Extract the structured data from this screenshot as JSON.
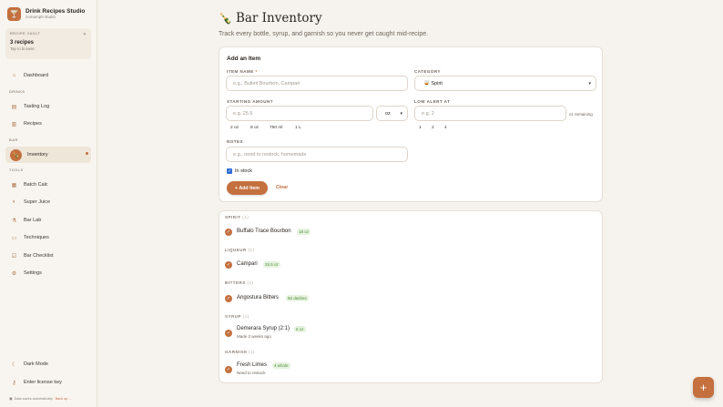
{
  "brand": {
    "name": "Drink Recipes Studio",
    "subtitle": "zomamp8 studio",
    "logo_icon": "glass-icon"
  },
  "vault": {
    "label": "RECIPE VAULT",
    "count": "3 recipes",
    "hint": "Tap to browse"
  },
  "nav": {
    "dashboard": "Dashboard",
    "drinks_label": "DRINKS",
    "tasting_log": "Tasting Log",
    "recipes": "Recipes",
    "bar_label": "BAR",
    "inventory": "Inventory",
    "tools_label": "TOOLS",
    "batch_calc": "Batch Calc",
    "super_juice": "Super Juice",
    "bar_lab": "Bar Lab",
    "techniques": "Techniques",
    "bar_checklist": "Bar Checklist",
    "settings": "Settings",
    "dark_mode": "Dark Mode",
    "license": "Enter license key"
  },
  "footer": {
    "text": "Data saves automatically.",
    "link": "Back up ..."
  },
  "page": {
    "title": "Bar Inventory",
    "subtitle": "Track every bottle, syrup, and garnish so you never get caught mid-recipe."
  },
  "form": {
    "title": "Add an Item",
    "item_name_label": "ITEM NAME",
    "required_mark": "*",
    "item_name_placeholder": "e.g., Bulleit Bourbon, Campari",
    "category_label": "CATEGORY",
    "category_value": "🥃 Spirit",
    "starting_amount_label": "STARTING AMOUNT",
    "starting_amount_placeholder": "e.g. 25.5",
    "unit_value": "oz",
    "low_alert_label": "LOW ALERT AT",
    "low_alert_placeholder": "e.g. 2",
    "or_remaining": "oz remaining",
    "amount_presets": [
      "2 oz",
      "8 oz",
      "750 ml",
      "1 L"
    ],
    "alert_presets": [
      "1",
      "2",
      "4"
    ],
    "notes_label": "NOTES",
    "notes_placeholder": "e.g., need to restock, homemade",
    "in_stock_label": "In stock",
    "in_stock": true,
    "add_button": "+ Add Item",
    "clear_button": "Clear"
  },
  "inventory": [
    {
      "category": "SPIRIT",
      "count": "(1)",
      "name": "Buffalo Trace Bourbon",
      "amount": "18 oz",
      "note": ""
    },
    {
      "category": "LIQUEUR",
      "count": "(1)",
      "name": "Campari",
      "amount": "25.5 oz",
      "note": ""
    },
    {
      "category": "BITTERS",
      "count": "(1)",
      "name": "Angostura Bitters",
      "amount": "50 dashes",
      "note": ""
    },
    {
      "category": "SYRUP",
      "count": "(1)",
      "name": "Demerara Syrup (2:1)",
      "amount": "6 oz",
      "note": "Made 2 weeks ago"
    },
    {
      "category": "GARNISH",
      "count": "(1)",
      "name": "Fresh Limes",
      "amount": "4 whole",
      "note": "Need to restock"
    }
  ],
  "fab": {
    "label": "+"
  },
  "colors": {
    "accent": "#c4703f",
    "badge_text": "#4f8f3a",
    "badge_bg": "#e6f3df",
    "checkbox": "#2f6fd6"
  }
}
